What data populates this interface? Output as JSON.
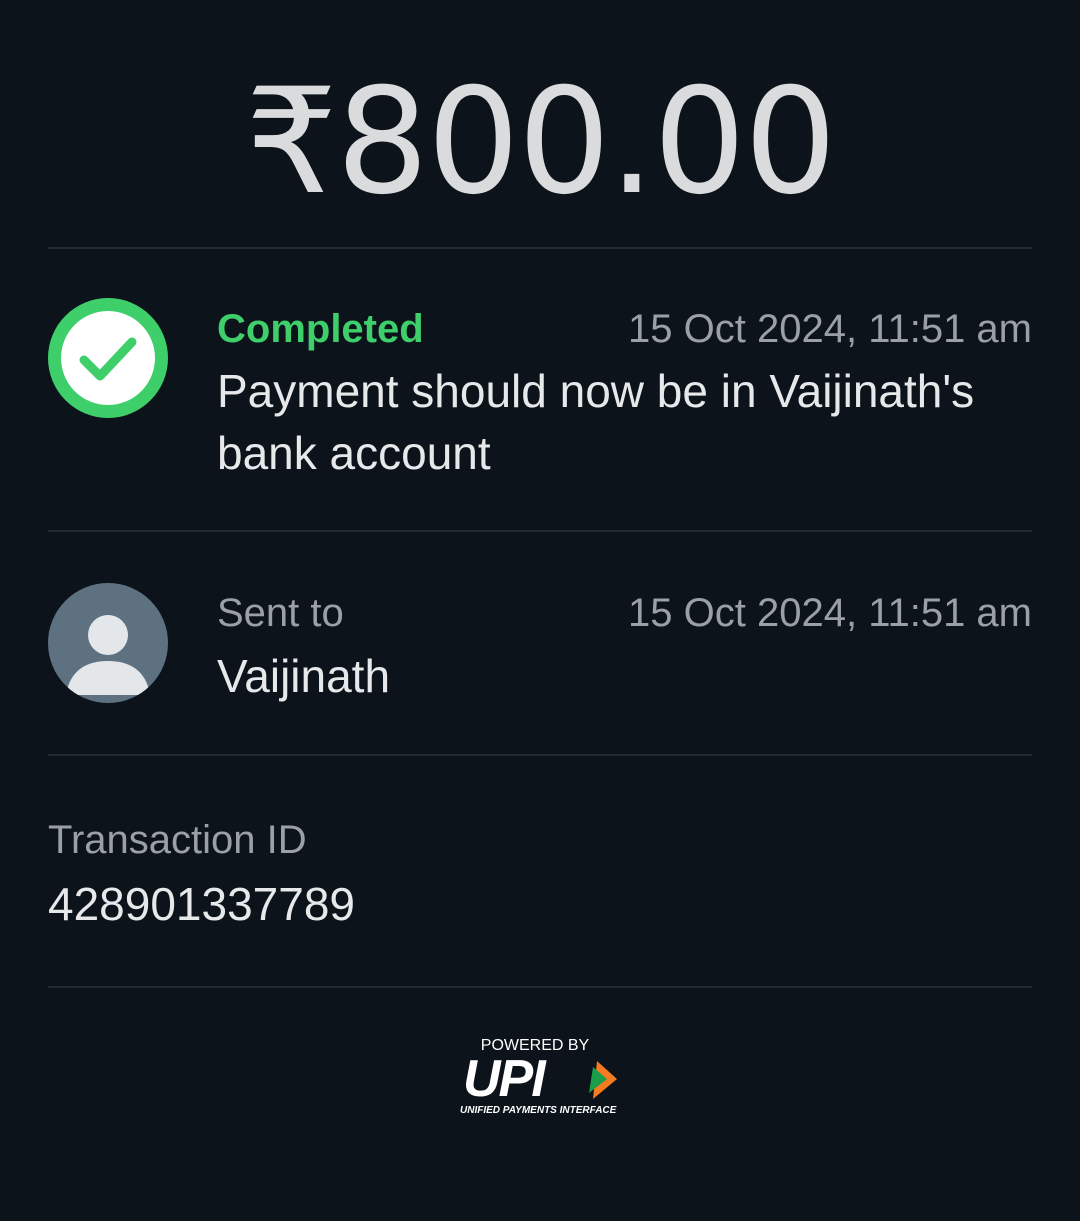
{
  "payment": {
    "amount": "₹800.00"
  },
  "status": {
    "label": "Completed",
    "timestamp": "15 Oct 2024, 11:51 am",
    "message": "Payment should now be in Vaijinath's bank account",
    "icon": "check-circle-icon",
    "color": "#3ecf6a"
  },
  "recipient": {
    "label": "Sent to",
    "name": "Vaijinath",
    "timestamp": "15 Oct 2024, 11:51 am",
    "icon": "person-icon"
  },
  "transaction": {
    "label": "Transaction ID",
    "id": "428901337789"
  },
  "footer": {
    "powered_by": "POWERED BY",
    "brand": "UPI",
    "tagline": "UNIFIED PAYMENTS INTERFACE"
  },
  "theme": {
    "background": "#0c131a",
    "divider": "#232b33",
    "accent_green": "#3ecf6a",
    "upi_orange": "#f47b20",
    "upi_green": "#1a9e4b"
  }
}
